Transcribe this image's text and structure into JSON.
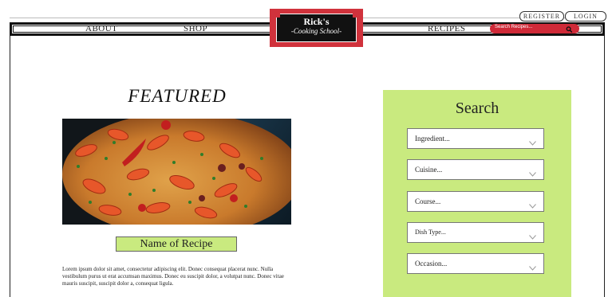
{
  "nav": {
    "about": "ABOUT",
    "shop": "SHOP",
    "recipes": "RECIPES"
  },
  "logo": {
    "title": "Rick's",
    "subtitle": "Cooking School"
  },
  "auth": {
    "register": "REGISTER",
    "login": "LOGIN"
  },
  "site_search": {
    "placeholder": "Search Recipes...",
    "icon": "search-icon"
  },
  "featured": {
    "heading": "FEATURED",
    "image": "paella-photo",
    "recipe_name": "Name of Recipe",
    "description": "Lorem ipsum dolor sit amet, consectetur adipiscing elit. Donec consequat placerat nunc. Nulla vestibulum purus ut erat accumsan maximus. Donec eu suscipit dolor, a volutpat nunc. Donec vitae mauris suscipit, suscipit dolor a, consequat ligula."
  },
  "search_panel": {
    "title": "Search",
    "filters": [
      {
        "label": "Ingredient..."
      },
      {
        "label": "Cuisine..."
      },
      {
        "label": "Course..."
      },
      {
        "label": "Dish Type..."
      },
      {
        "label": "Occasion..."
      }
    ]
  },
  "colors": {
    "accent_green": "#c9ea7f",
    "brand_red": "#d0323c"
  }
}
